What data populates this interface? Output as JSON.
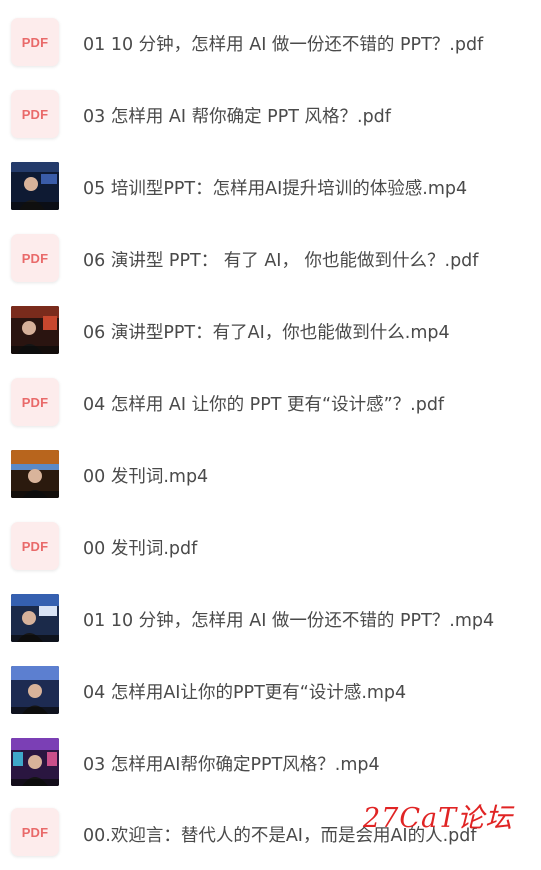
{
  "files": [
    {
      "type": "pdf",
      "icon_label": "PDF",
      "name": "01 10 分钟，怎样用 AI 做一份还不错的 PPT？.pdf"
    },
    {
      "type": "pdf",
      "icon_label": "PDF",
      "name": "03 怎样用 AI 帮你确定 PPT 风格？.pdf"
    },
    {
      "type": "video",
      "name": "05 培训型PPT：怎样用AI提升培训的体验感.mp4"
    },
    {
      "type": "pdf",
      "icon_label": "PDF",
      "name": "06 演讲型 PPT： 有了 AI， 你也能做到什么？.pdf"
    },
    {
      "type": "video",
      "name": "06 演讲型PPT：有了AI，你也能做到什么.mp4"
    },
    {
      "type": "pdf",
      "icon_label": "PDF",
      "name": "04 怎样用 AI 让你的 PPT 更有“设计感”？.pdf"
    },
    {
      "type": "video",
      "name": "00 发刊词.mp4"
    },
    {
      "type": "pdf",
      "icon_label": "PDF",
      "name": "00 发刊词.pdf"
    },
    {
      "type": "video",
      "name": "01 10 分钟，怎样用 AI 做一份还不错的 PPT？.mp4"
    },
    {
      "type": "video",
      "name": "04 怎样用AI让你的PPT更有“设计感.mp4"
    },
    {
      "type": "video",
      "name": "03 怎样用AI帮你确定PPT风格？.mp4"
    },
    {
      "type": "pdf",
      "icon_label": "PDF",
      "name": "00.欢迎言：替代人的不是AI，而是会用AI的人.pdf"
    }
  ],
  "watermark": "27CaT论坛",
  "colors": {
    "pdf_bg": "#fdecec",
    "pdf_text": "#e96a6a",
    "text": "#4a4a4a",
    "watermark": "#e02424"
  }
}
